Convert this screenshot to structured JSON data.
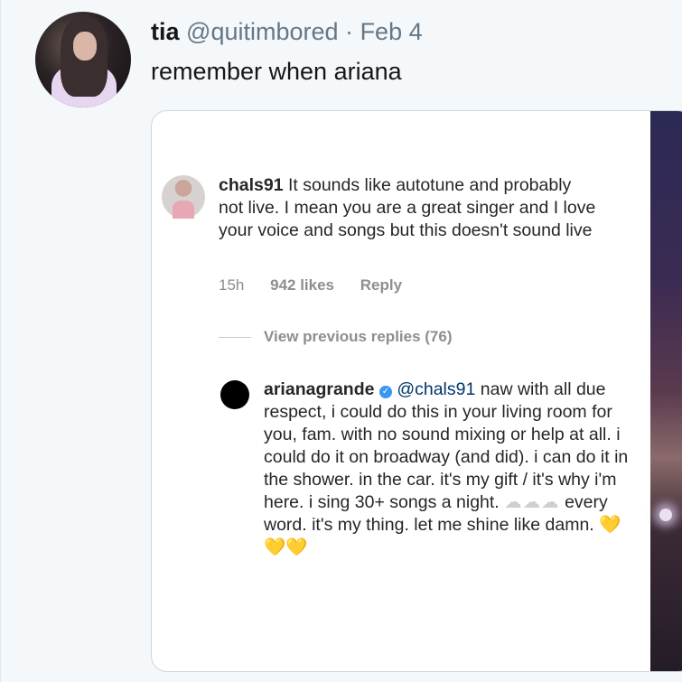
{
  "tweet": {
    "display_name": "tia",
    "handle": "@quitimbored",
    "separator": "·",
    "date": "Feb 4",
    "text": "remember when ariana"
  },
  "instagram": {
    "comment1": {
      "username": "chals91",
      "text": "It sounds like autotune and probably not live. I mean you are a great singer and I love your voice and songs but this doesn't sound live",
      "time": "15h",
      "likes": "942 likes",
      "reply": "Reply"
    },
    "view_previous": "View previous replies (76)",
    "comment2": {
      "username": "arianagrande",
      "verified_icon": "verified-badge-icon",
      "mention": "@chals91",
      "text_part1": "naw with all due respect, i could do this in your living room for you, fam. with no sound mixing or help at all. i could do it on broadway (and did). i can do it in the shower. in the car. it's my gift / it's why i'm here. i sing 30+ songs a night.",
      "clouds": "☁☁☁",
      "text_part2": "every word. it's my thing. let me shine like damn.",
      "hearts": "💛💛💛"
    }
  },
  "colors": {
    "background": "#f5f8fa",
    "handle": "#657786",
    "ig_text": "#262626",
    "ig_meta": "#8e8e8e",
    "verified": "#3897f0"
  }
}
